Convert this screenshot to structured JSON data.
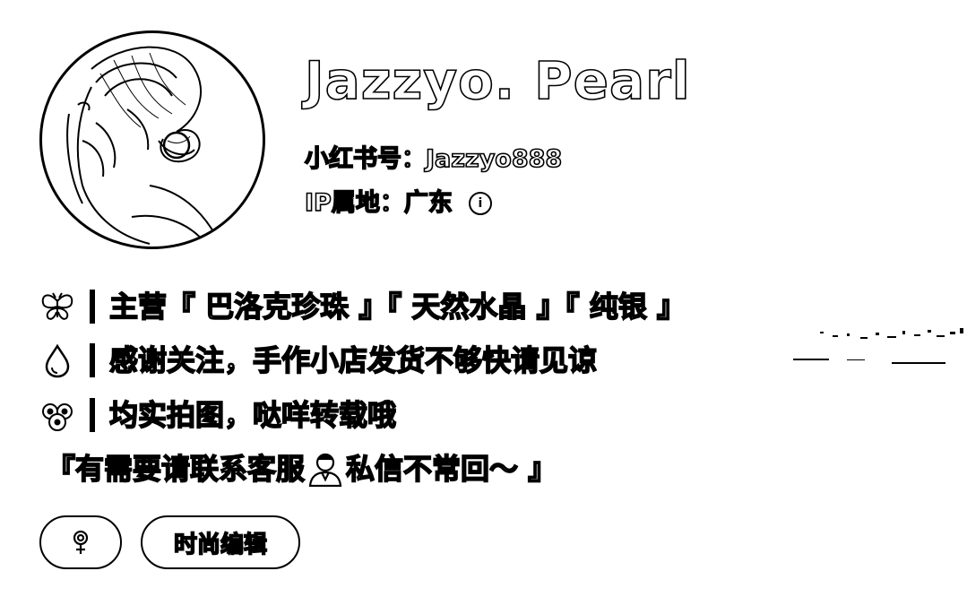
{
  "profile": {
    "display_name": "Jazzyo. Pearl",
    "account_id": "小红书号：Jazzyo888",
    "ip_location": "IP属地：广东",
    "info_icon": "info-icon"
  },
  "bio": {
    "line1": {
      "icon": "butterfly-icon",
      "text": "主营『 巴洛克珍珠 』『 天然水晶 』『 纯银 』"
    },
    "line2": {
      "icon": "droplet-icon",
      "text": "感谢关注，手作小店发货不够快请见谅"
    },
    "line3": {
      "icon": "flower-icon",
      "text": "均实拍图，哒咩转载哦"
    },
    "line4": {
      "text_before": "『有需要请联系客服",
      "icon": "person-icon",
      "text_after": "私信不常回～ 』"
    }
  },
  "tags": [
    {
      "icon": "female-icon",
      "label": ""
    },
    {
      "label": "时尚编辑"
    }
  ]
}
